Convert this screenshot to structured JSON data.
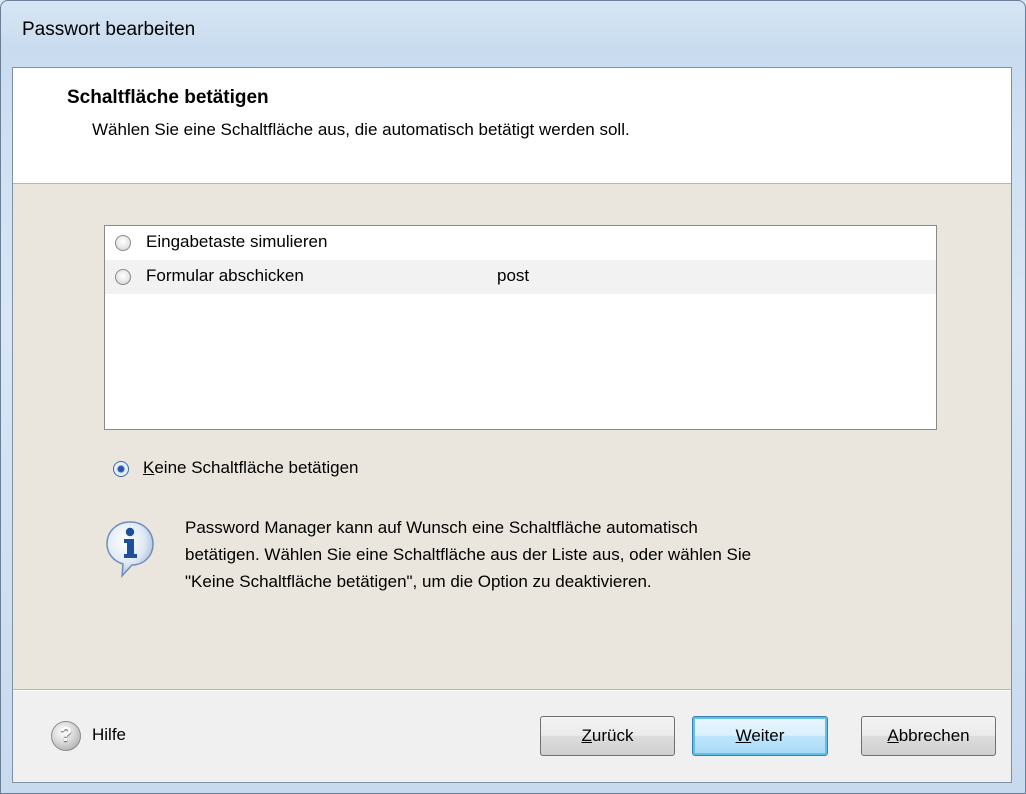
{
  "window": {
    "title": "Passwort bearbeiten"
  },
  "header": {
    "title": "Schaltfläche betätigen",
    "subtitle": "Wählen Sie eine Schaltfläche aus, die automatisch betätigt werden soll."
  },
  "button_list": {
    "rows": [
      {
        "label": "Eingabetaste simulieren",
        "value": "",
        "selected": false
      },
      {
        "label": "Formular abschicken",
        "value": "post",
        "selected": false
      }
    ]
  },
  "none_option": {
    "accel": "K",
    "rest": "eine Schaltfläche betätigen",
    "selected": true
  },
  "info": {
    "icon": "info-icon",
    "lines": [
      "Password Manager kann auf Wunsch eine Schaltfläche automatisch",
      "betätigen. Wählen Sie eine Schaltfläche aus der Liste aus, oder wählen Sie",
      "\"Keine Schaltfläche betätigen\", um die Option zu deaktivieren."
    ]
  },
  "footer": {
    "help_label": "Hilfe",
    "help_icon_glyph": "?",
    "back": {
      "accel": "Z",
      "rest": "urück"
    },
    "next": {
      "accel": "W",
      "rest": "eiter"
    },
    "cancel": {
      "accel": "A",
      "rest": "bbrechen"
    }
  },
  "colors": {
    "dialog_bg": "#ebe6dd",
    "header_bg": "#ffffff",
    "default_button": "#bee6fd"
  }
}
